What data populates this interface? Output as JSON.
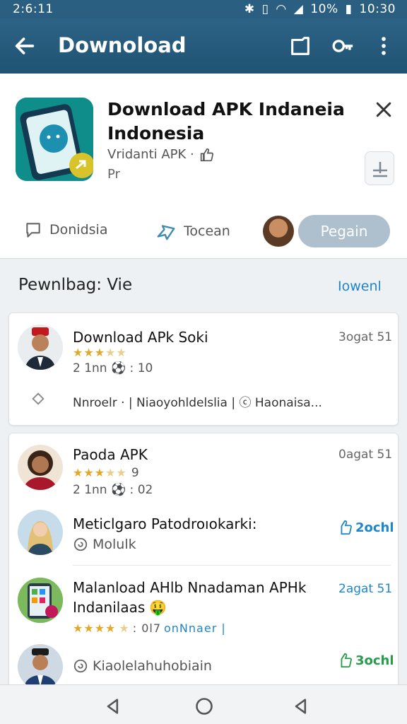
{
  "statusbar": {
    "time_left": "2:6:11",
    "battery": "10%",
    "time_right": "10:30"
  },
  "appbar": {
    "title": "Downoload",
    "back_icon": "arrow-left-icon",
    "icons": [
      "folder-icon",
      "key-icon",
      "more-vert-icon"
    ]
  },
  "header": {
    "title_line1": "Download APK Indaneia",
    "title_line2": "Indonesia",
    "subtitle": "Vridanti APK ·",
    "subtitle2": "Pr",
    "actions": [
      {
        "label": "Donidsia",
        "icon": "comment-icon"
      },
      {
        "label": "Tocean",
        "icon": "share-icon"
      }
    ],
    "primary_button": "Pegain"
  },
  "section": {
    "title": "Pewnlbag: Vie",
    "link": "Iowenl"
  },
  "card1": {
    "title": "Download APk Soki",
    "date": "3ogat 51",
    "rating": 3.5,
    "meta": "2 1nn ⚽ : 10",
    "tags": "Nnroelr · | Niaoyohldelslia | ⓒ Haonaisa..."
  },
  "card2": {
    "items": [
      {
        "title": "Paoda APK",
        "date": "0agat 51",
        "rating": 3.5,
        "rating_value": "9",
        "meta": "2 1nn ⚽ : 02"
      },
      {
        "title": "Meticlgaro Patodroıokarki:",
        "sub": "Molulk",
        "pill": "2ochl",
        "pill_color": "#1f86c8"
      },
      {
        "title": "Malanload AHlb Nnadaman APHk",
        "title2": "Indanilaas",
        "emoji": "🤑",
        "date": "2agat 51",
        "rating": 4,
        "rating_text": ": 0l7",
        "link": "onNnaer |"
      },
      {
        "title": "Kiaolelahuhobiain",
        "pill": "3ochl",
        "pill_color": "#2a9b4c"
      }
    ]
  }
}
